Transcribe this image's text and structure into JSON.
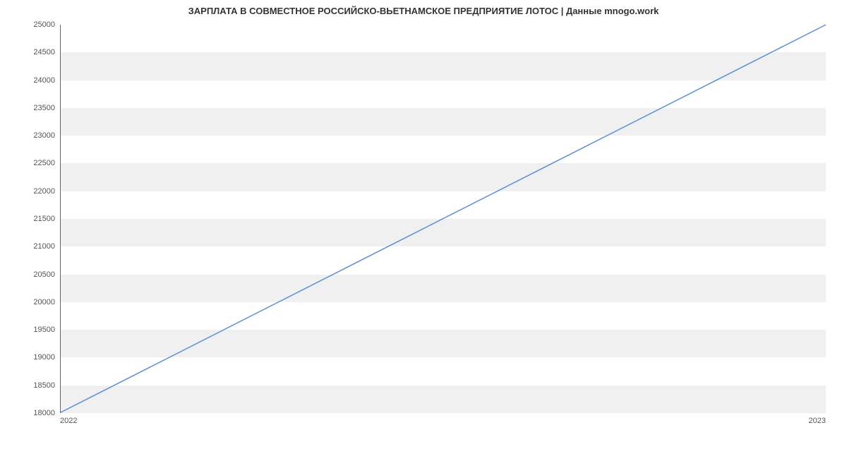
{
  "chart_data": {
    "type": "line",
    "title": "ЗАРПЛАТА В  СОВМЕСТНОЕ РОССИЙСКО-ВЬЕТНАМСКОЕ ПРЕДПРИЯТИЕ ЛОТОС | Данные mnogo.work",
    "xlabel": "",
    "ylabel": "",
    "x": [
      2022,
      2023
    ],
    "values": [
      18000,
      25000
    ],
    "xlim": [
      2022,
      2023
    ],
    "ylim": [
      18000,
      25000
    ],
    "x_ticks": [
      2022,
      2023
    ],
    "y_ticks": [
      18000,
      18500,
      19000,
      19500,
      20000,
      20500,
      21000,
      21500,
      22000,
      22500,
      23000,
      23500,
      24000,
      24500,
      25000
    ],
    "line_color": "#5b8fd6",
    "band_color": "#f0f0f0"
  }
}
